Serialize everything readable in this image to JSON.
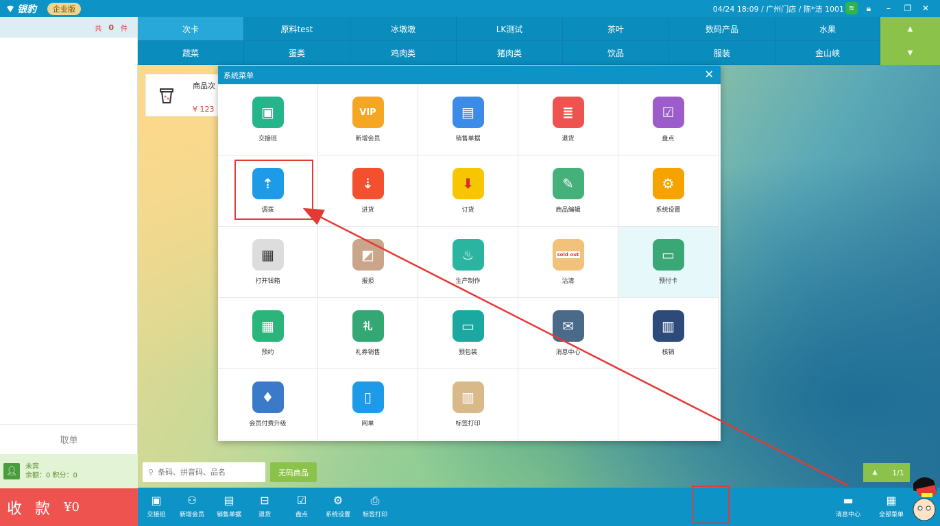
{
  "topbar": {
    "logo_text": "银豹",
    "edition": "企业版",
    "status": "04/24 18:09 / 广州门店 / 陈*洁 1001",
    "icons": [
      "wifi-icon",
      "lock-icon",
      "minimize-icon",
      "maximize-icon",
      "close-icon"
    ]
  },
  "cart": {
    "prefix": "共",
    "count": "0",
    "suffix": "件"
  },
  "categories": {
    "row1": [
      "次卡",
      "原料test",
      "冰墩墩",
      "LK测试",
      "茶叶",
      "数码产品",
      "水果"
    ],
    "row2": [
      "蔬菜",
      "蛋类",
      "鸡肉类",
      "猪肉类",
      "饮品",
      "服装",
      "金山峡"
    ],
    "active": "次卡"
  },
  "product": {
    "name": "商品次",
    "price": "¥ 123"
  },
  "left": {
    "cancel": "取单",
    "member_name": "未宾",
    "member_balance": "余额：0 积分：0",
    "pay_label": "收 款",
    "pay_amount": "¥0"
  },
  "search": {
    "placeholder": "条码、拼音码、品名",
    "no_code_button": "无码商品"
  },
  "paging": {
    "page": "1/1"
  },
  "toolbar": {
    "items": [
      "交接班",
      "新增会员",
      "销售单据",
      "退货",
      "盘点",
      "系统设置",
      "标签打印"
    ],
    "message_center": "消息中心",
    "all_menu": "全部菜单"
  },
  "dialog": {
    "title": "系统菜单",
    "items": [
      "交接班",
      "新增会员",
      "销售单据",
      "退货",
      "盘点",
      "调拨",
      "进货",
      "订货",
      "商品编辑",
      "系统设置",
      "打开钱箱",
      "报损",
      "生产制作",
      "沽清",
      "预付卡",
      "预约",
      "礼券销售",
      "预包装",
      "消息中心",
      "核销",
      "会员付费升级",
      "网单",
      "标签打印"
    ],
    "badges": {
      "vip": "VIP",
      "sold_out": "sold out",
      "gift": "礼"
    }
  },
  "colors": {
    "primary": "#0e93c6",
    "accent_green": "#8bc34a",
    "pay_red": "#ef5350",
    "highlight_red": "#e53935"
  }
}
